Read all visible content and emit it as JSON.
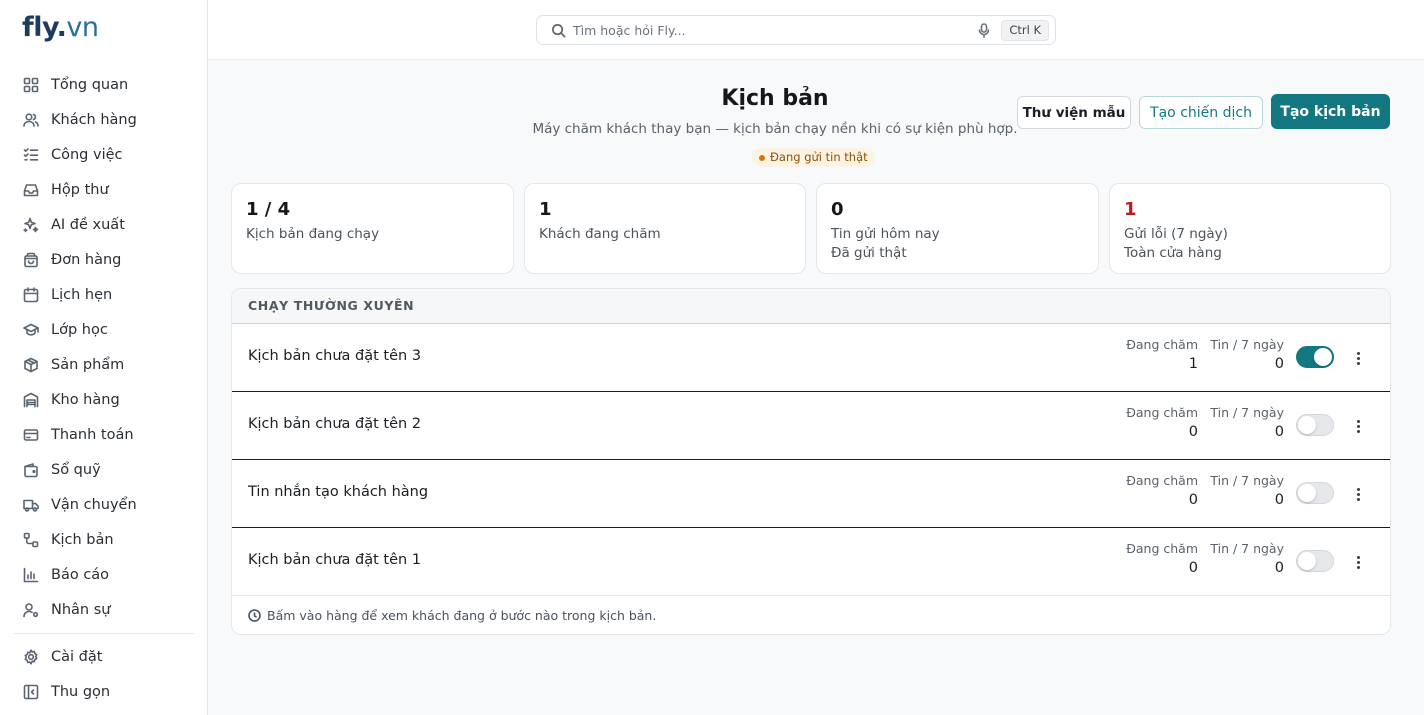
{
  "brand": {
    "name": "fly",
    "dot": ".",
    "tld": "vn"
  },
  "search": {
    "placeholder": "Tìm hoặc hỏi Fly...",
    "shortcut": "Ctrl K"
  },
  "sidebar": {
    "items": [
      {
        "label": "Tổng quan",
        "icon": "grid-icon"
      },
      {
        "label": "Khách hàng",
        "icon": "users-icon"
      },
      {
        "label": "Công việc",
        "icon": "checklist-icon"
      },
      {
        "label": "Hộp thư",
        "icon": "inbox-icon"
      },
      {
        "label": "AI đề xuất",
        "icon": "sparkles-icon"
      },
      {
        "label": "Đơn hàng",
        "icon": "shopping-bag-icon"
      },
      {
        "label": "Lịch hẹn",
        "icon": "calendar-icon"
      },
      {
        "label": "Lớp học",
        "icon": "graduation-cap-icon"
      },
      {
        "label": "Sản phẩm",
        "icon": "box-icon"
      },
      {
        "label": "Kho hàng",
        "icon": "warehouse-icon"
      },
      {
        "label": "Thanh toán",
        "icon": "credit-card-icon"
      },
      {
        "label": "Sổ quỹ",
        "icon": "wallet-icon"
      },
      {
        "label": "Vận chuyển",
        "icon": "truck-icon"
      },
      {
        "label": "Kịch bản",
        "icon": "workflow-icon"
      },
      {
        "label": "Báo cáo",
        "icon": "bar-chart-icon"
      },
      {
        "label": "Nhân sự",
        "icon": "user-gear-icon"
      }
    ],
    "settings": "Cài đặt",
    "collapse": "Thu gọn"
  },
  "header": {
    "title": "Kịch bản",
    "subtitle": "Máy chăm khách thay bạn — kịch bản chạy nền khi có sự kiện phù hợp.",
    "badge": "Đang gửi tin thật",
    "library_button": "Thư viện mẫu",
    "campaign_button": "Tạo chiến dịch",
    "create_button": "Tạo kịch bản"
  },
  "stats": [
    {
      "value": "1 / 4",
      "label": "Kịch bản đang chạy",
      "sub": ""
    },
    {
      "value": "1",
      "label": "Khách đang chăm",
      "sub": ""
    },
    {
      "value": "0",
      "label": "Tin gửi hôm nay",
      "sub": "Đã gửi thật"
    },
    {
      "value": "1",
      "label": "Gửi lỗi (7 ngày)",
      "sub": "Toàn cửa hàng"
    }
  ],
  "section": {
    "title": "CHẠY THƯỜNG XUYÊN",
    "col_active": "Đang chăm",
    "col_msgs": "Tin / 7 ngày",
    "rows": [
      {
        "name": "Kịch bản chưa đặt tên 3",
        "active": "1",
        "msgs": "0",
        "enabled": true
      },
      {
        "name": "Kịch bản chưa đặt tên 2",
        "active": "0",
        "msgs": "0",
        "enabled": false
      },
      {
        "name": "Tin nhắn tạo khách hàng",
        "active": "0",
        "msgs": "0",
        "enabled": false
      },
      {
        "name": "Kịch bản chưa đặt tên 1",
        "active": "0",
        "msgs": "0",
        "enabled": false
      }
    ],
    "hint": "Bấm vào hàng để xem khách đang ở bước nào trong kịch bản."
  },
  "colors": {
    "accent": "#137781",
    "error": "#b91c1c",
    "badge_bg": "#fdf3e4",
    "badge_text": "#8a5200"
  }
}
